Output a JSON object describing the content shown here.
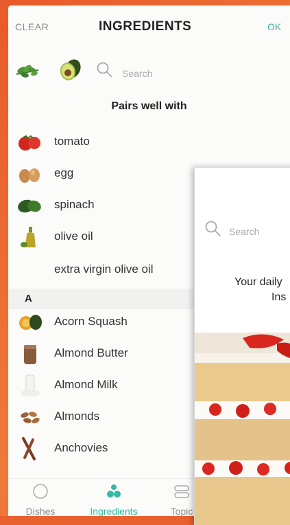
{
  "header": {
    "clear_label": "CLEAR",
    "title": "INGREDIENTS",
    "ok_label": "OK"
  },
  "selected_ingredients": [
    {
      "icon": "herb-icon"
    },
    {
      "icon": "avocado-icon"
    }
  ],
  "search": {
    "placeholder": "Search"
  },
  "pairs_title": "Pairs well with",
  "pairs": [
    {
      "label": "tomato",
      "icon": "tomato-icon"
    },
    {
      "label": "egg",
      "icon": "egg-icon"
    },
    {
      "label": "spinach",
      "icon": "spinach-icon"
    },
    {
      "label": "olive oil",
      "icon": "olive-oil-icon"
    },
    {
      "label": "extra virgin olive oil",
      "icon": ""
    }
  ],
  "section_letter": "A",
  "list": [
    {
      "label": "Acorn Squash",
      "icon": "acorn-squash-icon"
    },
    {
      "label": "Almond Butter",
      "icon": "almond-butter-icon"
    },
    {
      "label": "Almond Milk",
      "icon": "almond-milk-icon"
    },
    {
      "label": "Almonds",
      "icon": "almonds-icon"
    },
    {
      "label": "Anchovies",
      "icon": "anchovies-icon"
    }
  ],
  "tabs": [
    {
      "label": "Dishes",
      "active": false
    },
    {
      "label": "Ingredients",
      "active": true
    },
    {
      "label": "Topic",
      "active": false
    }
  ],
  "colors": {
    "accent": "#35b8a6",
    "background_edge": "#e8602c",
    "text": "#333333",
    "muted": "#8d8d8d"
  },
  "overlay": {
    "search_placeholder": "Search",
    "line1": "Your daily",
    "line2": "Ins"
  }
}
